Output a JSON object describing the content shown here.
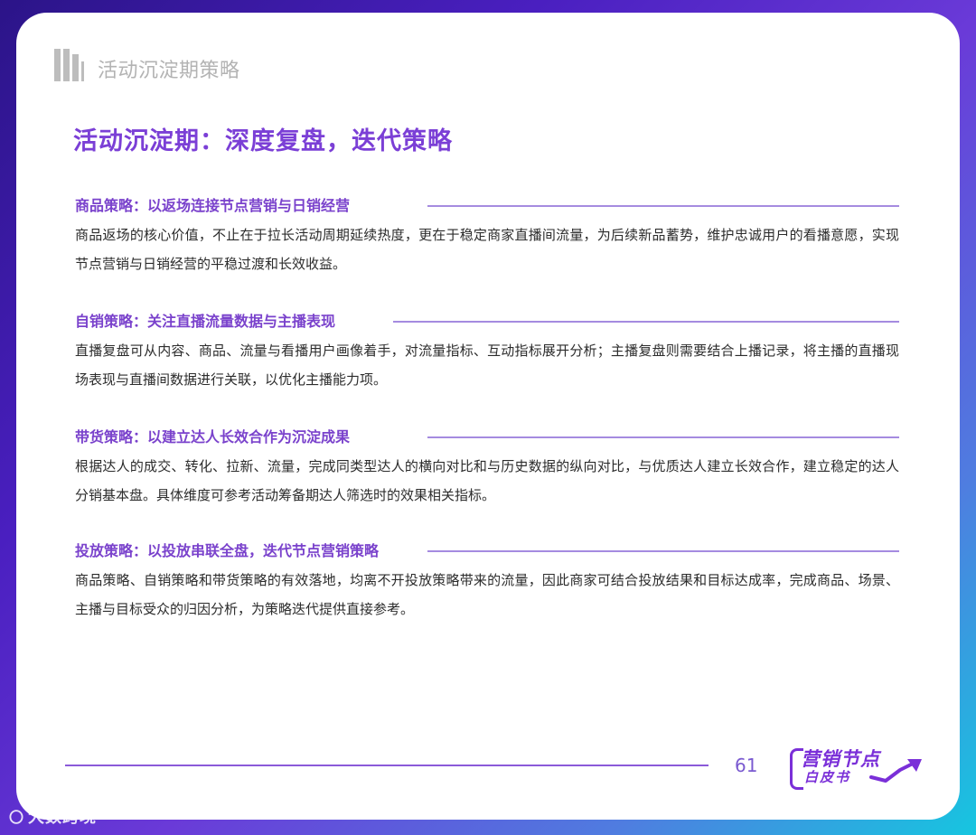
{
  "header": {
    "title": "活动沉淀期策略"
  },
  "page_title": "活动沉淀期：深度复盘，迭代策略",
  "sections": [
    {
      "title": "商品策略：以返场连接节点营销与日销经营",
      "body": "商品返场的核心价值，不止在于拉长活动周期延续热度，更在于稳定商家直播间流量，为后续新品蓄势，维护忠诚用户的看播意愿，实现节点营销与日销经营的平稳过渡和长效收益。"
    },
    {
      "title": "自销策略：关注直播流量数据与主播表现",
      "body": "直播复盘可从内容、商品、流量与看播用户画像着手，对流量指标、互动指标展开分析；主播复盘则需要结合上播记录，将主播的直播现场表现与直播间数据进行关联，以优化主播能力项。"
    },
    {
      "title": "带货策略：以建立达人长效合作为沉淀成果",
      "body": "根据达人的成交、转化、拉新、流量，完成同类型达人的横向对比和与历史数据的纵向对比，与优质达人建立长效合作，建立稳定的达人分销基本盘。具体维度可参考活动筹备期达人筛选时的效果相关指标。"
    },
    {
      "title": "投放策略：以投放串联全盘，迭代节点营销策略",
      "body": "商品策略、自销策略和带货策略的有效落地，均离不开投放策略带来的流量，因此商家可结合投放结果和目标达成率，完成商品、场景、主播与目标受众的归因分析，为策略迭代提供直接参考。"
    }
  ],
  "footer": {
    "page_number": "61",
    "logo_line1": "营销节点",
    "logo_line2": "白皮书"
  },
  "watermark": {
    "text": "大数跨境"
  },
  "colors": {
    "accent": "#7b3fd6",
    "section_title": "#7a42cc",
    "rule": "#a58be0",
    "body_text": "#2c2c2c"
  }
}
